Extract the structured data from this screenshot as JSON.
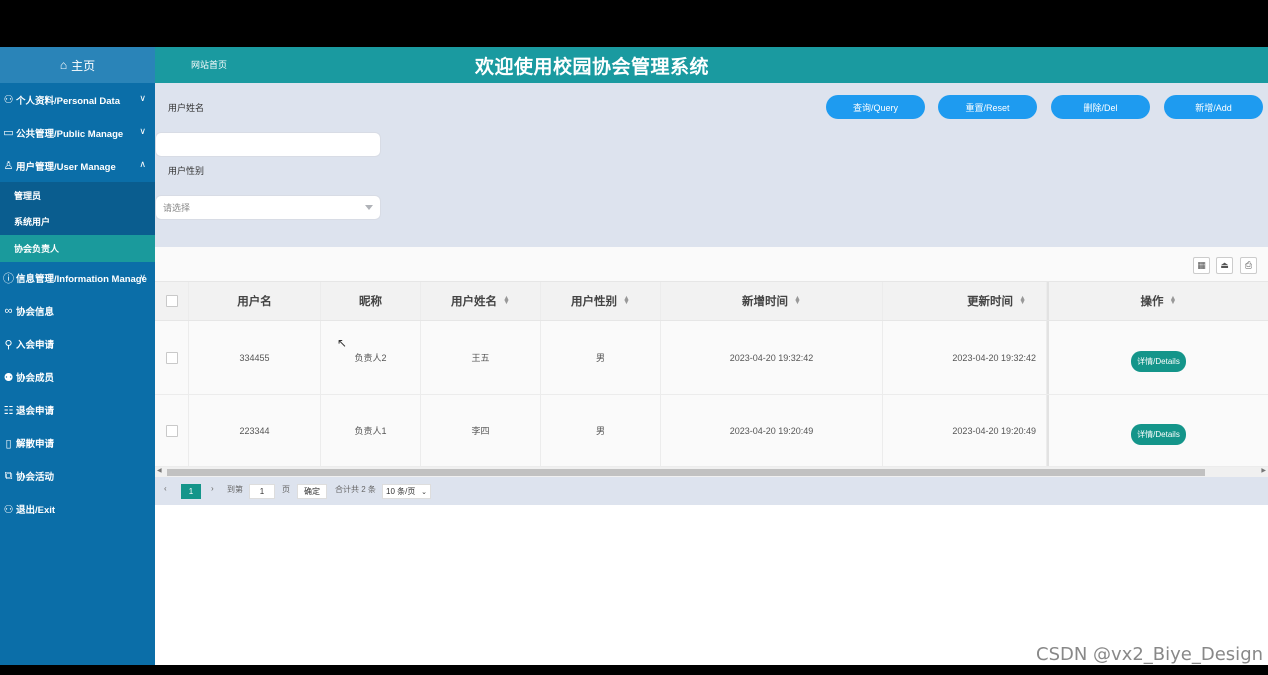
{
  "sidebar": {
    "home_label": "主页",
    "menus": [
      {
        "label": "个人资料/Personal Data",
        "icon": "user-card-icon",
        "expanded": false
      },
      {
        "label": "公共管理/Public Manage",
        "icon": "monitor-icon",
        "expanded": false
      },
      {
        "label": "用户管理/User Manage",
        "icon": "person-icon",
        "expanded": true
      }
    ],
    "sub_items": [
      "管理员",
      "系统用户",
      "协会负责人"
    ],
    "menus2": [
      {
        "label": "信息管理/Information Manage",
        "icon": "info-icon"
      },
      {
        "label": "协会信息",
        "icon": "link-icon"
      },
      {
        "label": "入会申请",
        "icon": "join-icon"
      },
      {
        "label": "协会成员",
        "icon": "members-icon"
      },
      {
        "label": "退会申请",
        "icon": "form-icon"
      },
      {
        "label": "解散申请",
        "icon": "doc-icon"
      },
      {
        "label": "协会活动",
        "icon": "activity-icon"
      },
      {
        "label": "退出/Exit",
        "icon": "exit-icon"
      }
    ]
  },
  "header": {
    "nav_link": "网站首页",
    "title": "欢迎使用校园协会管理系统"
  },
  "search": {
    "name_label": "用户姓名",
    "name_value": "",
    "gender_label": "用户性别",
    "gender_placeholder": "请选择",
    "buttons": {
      "query": "查询/Query",
      "reset": "重置/Reset",
      "delete": "删除/Del",
      "add": "新增/Add"
    }
  },
  "table": {
    "columns": [
      "用户名",
      "昵称",
      "用户姓名",
      "用户性别",
      "新增时间",
      "更新时间",
      "操作"
    ],
    "rows": [
      {
        "username": "334455",
        "nickname": "负责人2",
        "real_name": "王五",
        "gender": "男",
        "created": "2023-04-20 19:32:42",
        "updated": "2023-04-20 19:32:42",
        "action": "详情/Details"
      },
      {
        "username": "223344",
        "nickname": "负责人1",
        "real_name": "李四",
        "gender": "男",
        "created": "2023-04-20 19:20:49",
        "updated": "2023-04-20 19:20:49",
        "action": "详情/Details"
      }
    ]
  },
  "pagination": {
    "current_page": "1",
    "goto_label": "到第",
    "goto_value": "1",
    "page_unit": "页",
    "confirm": "确定",
    "total": "合计共 2 条",
    "page_size": "10 条/页"
  },
  "watermark": "CSDN @vx2_Biye_Design",
  "colors": {
    "sidebar": "#0b6ea8",
    "header": "#1a9aa0",
    "accent": "#14958a",
    "button": "#1e9bf0"
  }
}
